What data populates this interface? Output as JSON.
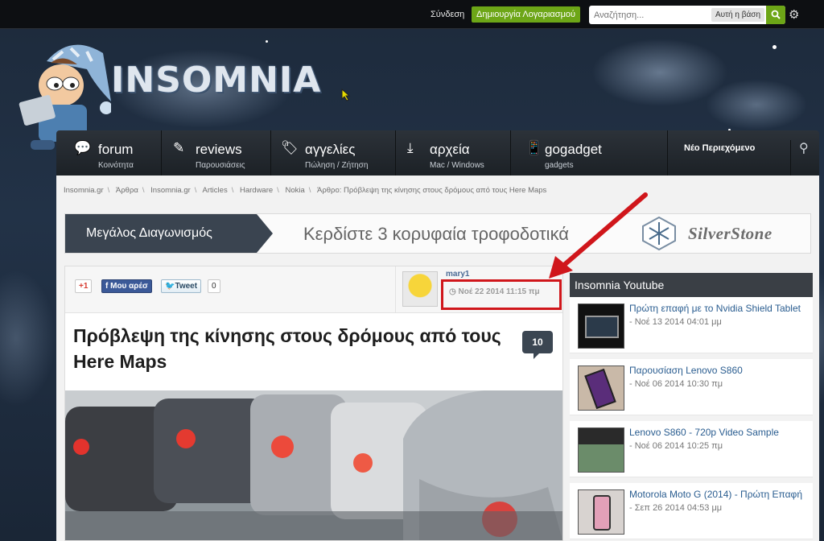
{
  "topbar": {
    "login": "Σύνδεση",
    "register": "Δημιουργία Λογαριασμού",
    "search_placeholder": "Αναζήτηση...",
    "search_scope": "Αυτή η βάση"
  },
  "logo": {
    "text": "INSOMNIA"
  },
  "nav": {
    "items": [
      {
        "label": "forum",
        "sub": "Κοινότητα"
      },
      {
        "label": "reviews",
        "sub": "Παρουσιάσεις"
      },
      {
        "label": "αγγελίες",
        "sub": "Πώληση / Ζήτηση"
      },
      {
        "label": "αρχεία",
        "sub": "Mac / Windows"
      },
      {
        "label": "gogadget",
        "sub": "gadgets"
      }
    ],
    "new_content": "Νέο Περιεχόμενο"
  },
  "breadcrumb": [
    "Insomnia.gr",
    "Άρθρα",
    "Insomnia.gr",
    "Articles",
    "Hardware",
    "Nokia",
    "Άρθρο: Πρόβλεψη της κίνησης στους δρόμους από τους Here Maps"
  ],
  "banner": {
    "tag": "Μεγάλος Διαγωνισμός",
    "text": "Κερδίστε 3 κορυφαία τροφοδοτικά",
    "brand": "SilverStone"
  },
  "article": {
    "share": {
      "gplus": "+1",
      "facebook": "Μου αρέσ",
      "tweet": "Tweet",
      "tweet_count": "0"
    },
    "author": "mary1",
    "date": "Νοέ 22 2014 11:15 πμ",
    "title": "Πρόβλεψη της κίνησης στους δρόμους από τους Here Maps",
    "comments": "10"
  },
  "sidebar": {
    "title": "Insomnia Youtube",
    "videos": [
      {
        "title": "Πρώτη επαφή με το Nvidia Shield Tablet",
        "date": "- Νοέ 13 2014 04:01 μμ"
      },
      {
        "title": "Παρουσίαση Lenovo S860",
        "date": "- Νοέ 06 2014 10:30 πμ"
      },
      {
        "title": "Lenovo S860 - 720p Video Sample",
        "date": "- Νοέ 06 2014 10:25 πμ"
      },
      {
        "title": "Motorola Moto G (2014) - Πρώτη Επαφή",
        "date": "- Σεπ 26 2014 04:53 μμ"
      }
    ]
  },
  "colors": {
    "accent_green": "#6da617",
    "highlight_red": "#d0161b",
    "nav_dark": "#2c3239"
  }
}
